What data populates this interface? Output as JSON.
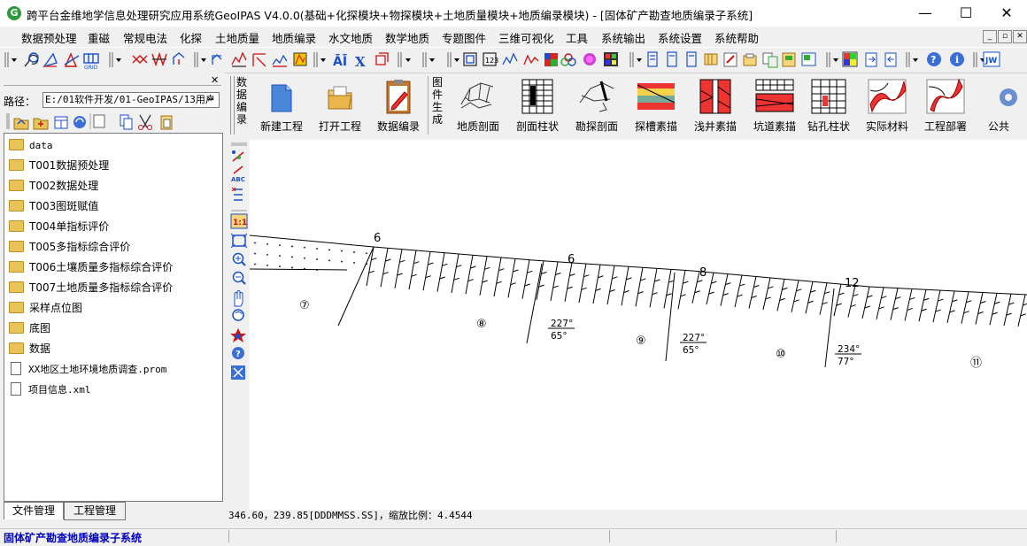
{
  "window": {
    "title": "跨平台金维地学信息处理研究应用系统GeoIPAS V4.0.0(基础+化探模块+物探模块+土地质量模块+地质编录模块) - [固体矿产勘查地质编录子系统]",
    "app_icon_glyph": "G",
    "minimize_glyph": "—",
    "maximize_glyph": "☐",
    "close_glyph": "✕"
  },
  "menu": {
    "items": [
      "数据预处理",
      "重磁",
      "常规电法",
      "化探",
      "土地质量",
      "地质编录",
      "水文地质",
      "数学地质",
      "专题图件",
      "三维可视化",
      "工具",
      "系统输出",
      "系统设置",
      "系统帮助"
    ],
    "mdi_minimize": "_",
    "mdi_restore": "▫",
    "mdi_close": "✕"
  },
  "left_panel": {
    "close_glyph": "✕",
    "path_label": "路径：",
    "path_value": "E:/01软件开发/01-GeoIPAS/13用户",
    "more_glyph": "»",
    "tree": [
      {
        "label": "data",
        "type": "folder"
      },
      {
        "label": "T001数据预处理",
        "type": "folder"
      },
      {
        "label": "T002数据处理",
        "type": "folder"
      },
      {
        "label": "T003图斑赋值",
        "type": "folder"
      },
      {
        "label": "T004单指标评价",
        "type": "folder"
      },
      {
        "label": "T005多指标综合评价",
        "type": "folder"
      },
      {
        "label": "T006土壤质量多指标综合评价",
        "type": "folder"
      },
      {
        "label": "T007土地质量多指标综合评价",
        "type": "folder"
      },
      {
        "label": "采样点位图",
        "type": "folder"
      },
      {
        "label": "底图",
        "type": "folder"
      },
      {
        "label": "数据",
        "type": "folder"
      },
      {
        "label": "XX地区土地环境地质调查.prom",
        "type": "file"
      },
      {
        "label": "项目信息.xml",
        "type": "file"
      }
    ],
    "tabs": [
      "文件管理",
      "工程管理"
    ]
  },
  "big_toolbar": {
    "group1_label": [
      "数",
      "据",
      "编",
      "录"
    ],
    "group1_buttons": [
      "新建工程",
      "打开工程",
      "数据编录"
    ],
    "group2_label": [
      "图",
      "件",
      "生",
      "成"
    ],
    "group2_buttons": [
      "地质剖面",
      "剖面柱状",
      "勘探剖面",
      "探槽素描",
      "浅井素描",
      "坑道素描",
      "钻孔柱状",
      "实际材料",
      "工程部署",
      "公共"
    ]
  },
  "canvas": {
    "thickness_labels": [
      "6",
      "6",
      "8",
      "12"
    ],
    "layer_ids": [
      "⑦",
      "⑧",
      "⑨",
      "⑩",
      "⑪"
    ],
    "attitudes": [
      {
        "dip_dir": "227°",
        "dip": "65°"
      },
      {
        "dip_dir": "227°",
        "dip": "65°"
      },
      {
        "dip_dir": "234°",
        "dip": "77°"
      }
    ],
    "colors": {
      "line": "#000000",
      "background": "#ffffff"
    }
  },
  "coords_text": "346.60，239.85[DDDMMSS.SS]，缩放比例：4.4544",
  "status": {
    "text": "固体矿产勘查地质编录子系统",
    "text_color": "#0000c0"
  }
}
